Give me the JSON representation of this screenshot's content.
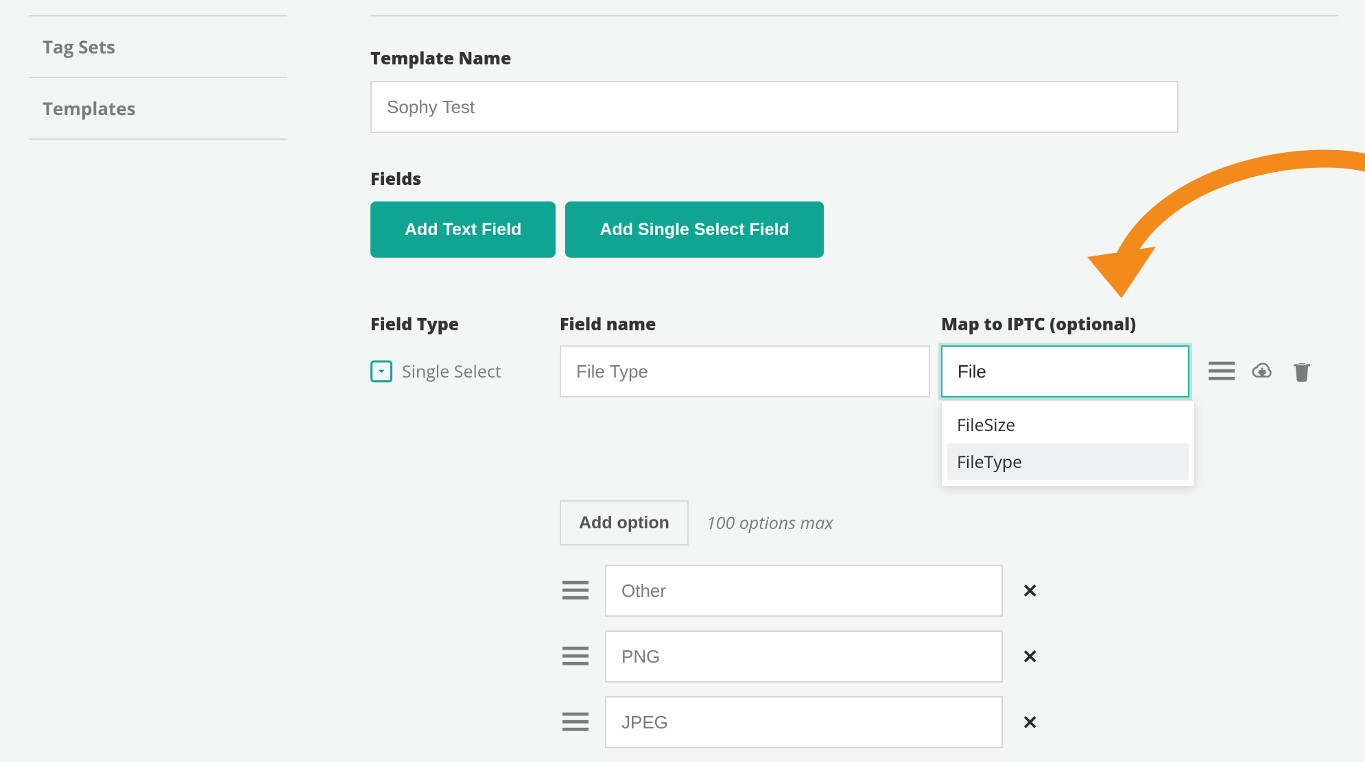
{
  "sidebar": {
    "items": [
      {
        "label": "Tag Sets"
      },
      {
        "label": "Templates"
      }
    ]
  },
  "templateName": {
    "label": "Template Name",
    "value": "Sophy Test"
  },
  "fields": {
    "label": "Fields",
    "addTextLabel": "Add Text Field",
    "addSelectLabel": "Add Single Select Field"
  },
  "columns": {
    "fieldType": "Field Type",
    "fieldName": "Field name",
    "mapIptc": "Map to IPTC (optional)"
  },
  "fieldRow": {
    "typeLabel": "Single Select",
    "nameValue": "File Type",
    "iptcValue": "File",
    "dropdown": [
      {
        "label": "FileSize",
        "hover": false
      },
      {
        "label": "FileType",
        "hover": true
      }
    ]
  },
  "addOption": {
    "buttonLabel": "Add option",
    "hint": "100 options max"
  },
  "options": [
    {
      "value": "Other"
    },
    {
      "value": "PNG"
    },
    {
      "value": "JPEG"
    }
  ],
  "colors": {
    "accent": "#0fa592",
    "arrow": "#f28a1c"
  }
}
